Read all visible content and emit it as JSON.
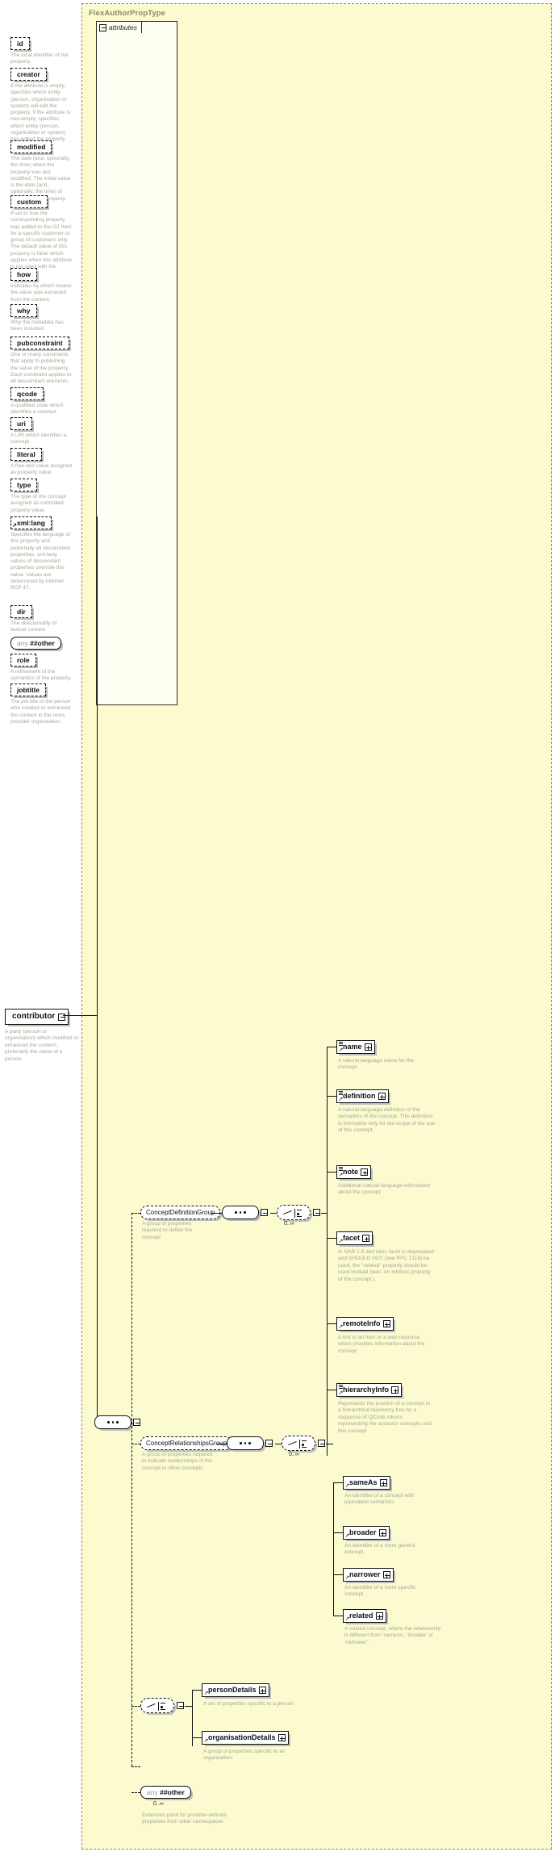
{
  "type_panel": {
    "title": "FlexAuthorPropType"
  },
  "attributes_section": {
    "label": "attributes",
    "items": [
      {
        "name": "id",
        "desc": "The local identifier of the property."
      },
      {
        "name": "creator",
        "desc": "If the attribute is empty, specifies which entity (person, organisation or system) will edit the property. If the attribute is non-empty, specifies which entity (person, organisation or system) has edited the property."
      },
      {
        "name": "modified",
        "desc": "The date (and, optionally, the time) when the property was last modified. The initial value is the date (and, optionally, the time) of creation of the property."
      },
      {
        "name": "custom",
        "desc": "If set to true the corresponding property was added to the G2 Item for a specific customer or group of customers only. The default value of this property is false which applies when this attribute is not used with the property."
      },
      {
        "name": "how",
        "desc": "Indicates by which means the value was extracted from the content."
      },
      {
        "name": "why",
        "desc": "Why the metadata has been included."
      },
      {
        "name": "pubconstraint",
        "desc": "One or many constraints that apply to publishing the value of the property. Each constraint applies to all descendant elements."
      },
      {
        "name": "qcode",
        "desc": "A qualified code which identifies a concept."
      },
      {
        "name": "uri",
        "desc": "A URI which identifies a concept."
      },
      {
        "name": "literal",
        "desc": "A free-text value assigned as property value."
      },
      {
        "name": "type",
        "desc": "The type of the concept assigned as controlled property value."
      },
      {
        "name": "xml:lang",
        "desc": "Specifies the language of this property and potentially all descendant properties. xml:lang values of descendant properties override this value. Values are determined by Internet BCP 47."
      },
      {
        "name": "dir",
        "desc": "The directionality of textual content."
      },
      {
        "name": "any ##other",
        "desc": ""
      },
      {
        "name": "role",
        "desc": "A refinement of the semantics of the property."
      },
      {
        "name": "jobtitle",
        "desc": "The job title of the person who created or enhanced the content in the news provider organisation."
      }
    ]
  },
  "root_element": {
    "name": "contributor",
    "desc": "A party (person or organisation) which modified or enhanced the content, preferably the name of a person."
  },
  "groups": {
    "concept_definition": {
      "name": "ConceptDefinitionGroup",
      "desc": "A group of properites required to define the concept",
      "occurs": "0..∞"
    },
    "concept_relationships": {
      "name": "ConceptRelationshipsGroup",
      "desc": "A group of properties required to indicate relationships of the concept to other concepts",
      "occurs": "0..∞"
    }
  },
  "elements": {
    "definition_group_children": [
      {
        "name": "name",
        "desc": "A natural language name for the concept."
      },
      {
        "name": "definition",
        "desc": "A natural language definition of the semantics of the concept. This definition is normative only for the scope of the use of this concept."
      },
      {
        "name": "note",
        "desc": "Additional natural language information about the concept."
      },
      {
        "name": "facet",
        "desc": "In NAR 1.8 and later, facet is deprecated and SHOULD NOT (see RFC 2119) be used, the \"related\" property should be used instead (was: An intrinsic property of the concept.)"
      },
      {
        "name": "remoteInfo",
        "desc": "A link to an item or a web resource which provides information about the concept"
      },
      {
        "name": "hierarchyInfo",
        "desc": "Represents the position of a concept in a hierarchical taxonomy tree by a sequence of QCode tokens representing the ancestor concepts and this concept"
      }
    ],
    "relationships_group_children": [
      {
        "name": "sameAs",
        "desc": "An identifier of a concept with equivalent semantics"
      },
      {
        "name": "broader",
        "desc": "An identifier of a more generic concept."
      },
      {
        "name": "narrower",
        "desc": "An identifier of a more specific concept."
      },
      {
        "name": "related",
        "desc": "A related concept, where the relationship is different from 'sameAs', 'broader' or 'narrower'."
      }
    ],
    "details_choice_children": [
      {
        "name": "personDetails",
        "desc": "A set of properties specific to a person"
      },
      {
        "name": "organisationDetails",
        "desc": "A group of properties specific to an organisation"
      }
    ],
    "any_other": {
      "prefix": "any",
      "name": "##other",
      "occurs": "0..∞",
      "desc": "Extension point for provider-defined properties from other namespaces"
    }
  },
  "colors": {
    "panel_background": "#fbfbcf",
    "box_background": "#ffffff",
    "description_text": "#a7a79a",
    "title_text": "#8b8b5e",
    "line": "#111111",
    "shadow": "#bdbdbd"
  }
}
